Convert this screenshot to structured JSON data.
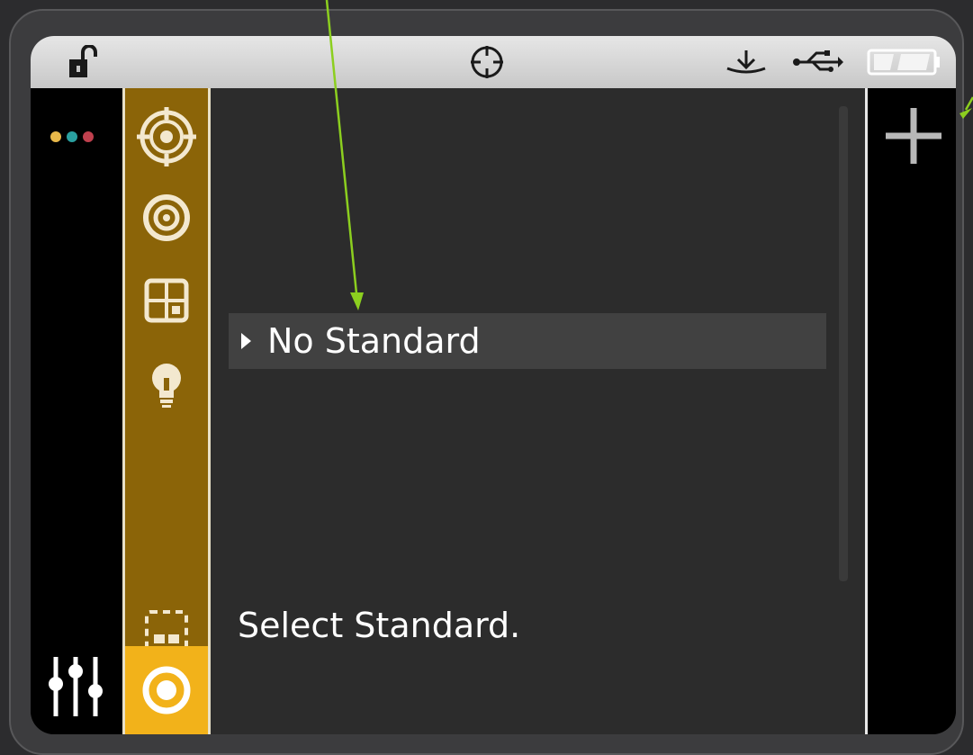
{
  "status_bar": {
    "lock_icon": "unlocked-padlock-icon",
    "center_icon": "crosshair-target-icon",
    "right_icons": [
      "calibration-tray-icon",
      "usb-icon",
      "battery-icon"
    ]
  },
  "left_column": {
    "indicator_dots": [
      "#e8b84a",
      "#2aa0a0",
      "#c0404e"
    ],
    "settings_icon": "sliders-icon"
  },
  "mode_bar": {
    "items": [
      "target-measure-icon",
      "concentric-circle-icon",
      "grid-view-icon",
      "lightbulb-icon",
      "dashed-selection-icon"
    ],
    "active_item": "measure-ring-icon",
    "colors": {
      "bar": "#8b6408",
      "active": "#f2b21a"
    }
  },
  "main": {
    "selected_row": {
      "label": "No Standard"
    },
    "prompt": "Select Standard."
  },
  "right_column": {
    "add_icon": "plus-icon"
  },
  "annotation_color": "#8ccf1f"
}
